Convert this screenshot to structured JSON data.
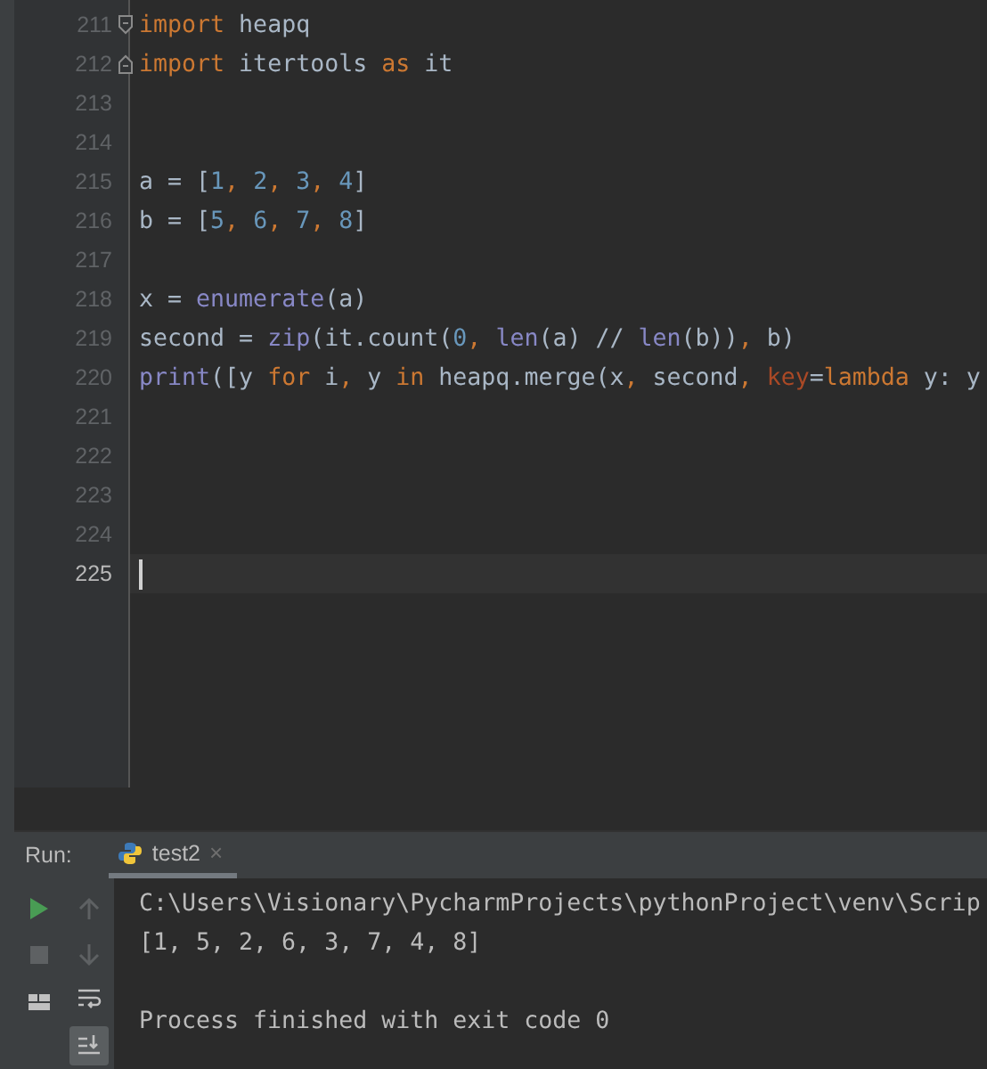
{
  "editor": {
    "lines": [
      {
        "number": "211",
        "fold_open": true,
        "current": false,
        "tokens": [
          {
            "kind": "keyword",
            "text": "import"
          },
          {
            "kind": "plain",
            "text": " heapq"
          }
        ]
      },
      {
        "number": "212",
        "fold_close": true,
        "current": false,
        "tokens": [
          {
            "kind": "keyword",
            "text": "import"
          },
          {
            "kind": "plain",
            "text": " itertools "
          },
          {
            "kind": "keyword",
            "text": "as"
          },
          {
            "kind": "plain",
            "text": " it"
          }
        ]
      },
      {
        "number": "213",
        "current": false
      },
      {
        "number": "214",
        "current": false
      },
      {
        "number": "215",
        "current": false,
        "tokens": [
          {
            "kind": "plain",
            "text": "a = ["
          },
          {
            "kind": "number",
            "text": "1"
          },
          {
            "kind": "comma",
            "text": ", "
          },
          {
            "kind": "number",
            "text": "2"
          },
          {
            "kind": "comma",
            "text": ", "
          },
          {
            "kind": "number",
            "text": "3"
          },
          {
            "kind": "comma",
            "text": ", "
          },
          {
            "kind": "number",
            "text": "4"
          },
          {
            "kind": "plain",
            "text": "]"
          }
        ]
      },
      {
        "number": "216",
        "current": false,
        "tokens": [
          {
            "kind": "plain",
            "text": "b = ["
          },
          {
            "kind": "number",
            "text": "5"
          },
          {
            "kind": "comma",
            "text": ", "
          },
          {
            "kind": "number",
            "text": "6"
          },
          {
            "kind": "comma",
            "text": ", "
          },
          {
            "kind": "number",
            "text": "7"
          },
          {
            "kind": "comma",
            "text": ", "
          },
          {
            "kind": "number",
            "text": "8"
          },
          {
            "kind": "plain",
            "text": "]"
          }
        ]
      },
      {
        "number": "217",
        "current": false
      },
      {
        "number": "218",
        "current": false,
        "tokens": [
          {
            "kind": "plain",
            "text": "x = "
          },
          {
            "kind": "builtin",
            "text": "enumerate"
          },
          {
            "kind": "plain",
            "text": "(a)"
          }
        ]
      },
      {
        "number": "219",
        "current": false,
        "tokens": [
          {
            "kind": "plain",
            "text": "second = "
          },
          {
            "kind": "builtin",
            "text": "zip"
          },
          {
            "kind": "plain",
            "text": "(it.count("
          },
          {
            "kind": "number",
            "text": "0"
          },
          {
            "kind": "comma",
            "text": ", "
          },
          {
            "kind": "builtin",
            "text": "len"
          },
          {
            "kind": "plain",
            "text": "(a) // "
          },
          {
            "kind": "builtin",
            "text": "len"
          },
          {
            "kind": "plain",
            "text": "(b))"
          },
          {
            "kind": "comma",
            "text": ", "
          },
          {
            "kind": "plain",
            "text": "b)"
          }
        ]
      },
      {
        "number": "220",
        "current": false,
        "tokens": [
          {
            "kind": "builtin",
            "text": "print"
          },
          {
            "kind": "plain",
            "text": "([y "
          },
          {
            "kind": "keyword",
            "text": "for"
          },
          {
            "kind": "plain",
            "text": " i"
          },
          {
            "kind": "comma",
            "text": ", "
          },
          {
            "kind": "plain",
            "text": "y "
          },
          {
            "kind": "keyword",
            "text": "in"
          },
          {
            "kind": "plain",
            "text": " heapq.merge(x"
          },
          {
            "kind": "comma",
            "text": ", "
          },
          {
            "kind": "plain",
            "text": "second"
          },
          {
            "kind": "comma",
            "text": ", "
          },
          {
            "kind": "param",
            "text": "key"
          },
          {
            "kind": "plain",
            "text": "="
          },
          {
            "kind": "keyword",
            "text": "lambda"
          },
          {
            "kind": "plain",
            "text": " y: y"
          }
        ]
      },
      {
        "number": "221",
        "current": false
      },
      {
        "number": "222",
        "current": false
      },
      {
        "number": "223",
        "current": false
      },
      {
        "number": "224",
        "current": false
      },
      {
        "number": "225",
        "current": true
      }
    ]
  },
  "run_panel": {
    "label": "Run:",
    "tabs": [
      {
        "label": "test2",
        "close": "×",
        "selected": true
      }
    ],
    "toolbar_columns": [
      [
        {
          "kind": "rerun",
          "disabled": false
        },
        {
          "kind": "stop",
          "disabled": true
        },
        {
          "kind": "layout",
          "disabled": false
        }
      ],
      [
        {
          "kind": "up",
          "disabled": true,
          "selected": false
        },
        {
          "kind": "down",
          "disabled": true,
          "selected": false
        },
        {
          "kind": "wrap",
          "disabled": false,
          "selected": false
        },
        {
          "kind": "scroll-end",
          "disabled": false,
          "selected": true
        }
      ]
    ],
    "console": [
      {
        "kind": "output",
        "text": "C:\\Users\\Visionary\\PycharmProjects\\pythonProject\\venv\\Scrip"
      },
      {
        "kind": "output",
        "text": "[1, 5, 2, 6, 3, 7, 4, 8]"
      },
      {
        "kind": "status",
        "text": "Process finished with exit code 0"
      }
    ]
  }
}
